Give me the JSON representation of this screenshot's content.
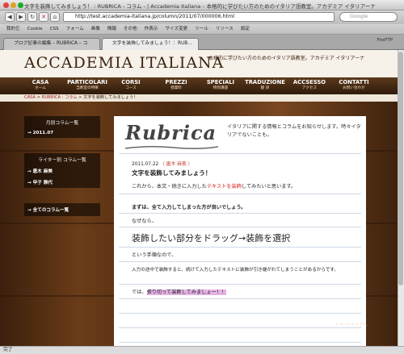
{
  "window": {
    "title": "文字を装飾してみましょう！ : RUBRICA - コラム - | Accademia Italiana – 本格的に学びたい方のためのイタリア語教室。アカデミア イタリアーナ"
  },
  "toolbar": {
    "url": "http://test.accademia-italiana.jp/column/2011/07/000006.html",
    "search_placeholder": "Google",
    "back": "◀",
    "forward": "▶",
    "reload": "↻",
    "home": "⌂"
  },
  "bookmarks": [
    "我的乞",
    "Cookie",
    "CSS",
    "フォーム",
    "画像",
    "情報",
    "その他",
    "作表示",
    "サイズ変更",
    "ツール",
    "リソース",
    "設定"
  ],
  "tabs": [
    {
      "label": "ブログ記事の編集 – RUBRICA – コ"
    },
    {
      "label": "文字を装飾してみましょう！：RUB…"
    }
  ],
  "ffftp_label": "FireFTP",
  "site": {
    "logo": "ACCADEMIA ITALIANA",
    "tagline": "本格的に学びたい方のためのイタリア語教室。アカデミア イタリアーナ",
    "nav": [
      {
        "en": "CASA",
        "jp": "ホーム"
      },
      {
        "en": "PARTICOLARI",
        "jp": "当教室の特徴"
      },
      {
        "en": "CORSI",
        "jp": "コース"
      },
      {
        "en": "PREZZI",
        "jp": "授業料"
      },
      {
        "en": "SPECIALI",
        "jp": "特別講座"
      },
      {
        "en": "TRADUZIONE",
        "jp": "翻 訳"
      },
      {
        "en": "ACCSESSO",
        "jp": "アクセス"
      },
      {
        "en": "CONTATTI",
        "jp": "お問い合わせ"
      }
    ],
    "breadcrumb": [
      "CASA",
      "RUBRICA : コラム",
      "文字を装飾してみましょう！"
    ],
    "sidebar": {
      "monthly_head": "月別コラム一覧",
      "monthly_items": [
        "→ 2011.07"
      ],
      "writer_head": "ライター別 コラム一覧",
      "writer_items": [
        "→ 唐木 麻美",
        "→ 甲子 雅代"
      ],
      "all_columns": "→ 全てのコラム一覧"
    },
    "content": {
      "logo": "Rubrica",
      "description": "イタリアに関する情報とコラムをお知らせします。時々イタリアでないことも。",
      "date": "2011.07.22",
      "author": "（ 唐木 麻美 ）",
      "title": "文字を装飾してみましょう！",
      "p1_before": "これから、本文・続きに入力した",
      "p1_red": "テキストを装飾",
      "p1_after": "してみたいと思います。",
      "p2": "まずは、全て入力してしまった方が良いでしょう。",
      "p3": "なぜなら、",
      "p4": "装飾したい部分をドラッグ→装飾を選択",
      "p5": "という手順なので、",
      "p6": "入力の途中で装飾すると、続けて入力したテキストに装飾が引き継がれてしまうことがあるからです。",
      "p7_before": "では、",
      "p7_highlight": "張り切って装飾してみましょー！！"
    },
    "pagetop": "| ページトップへ"
  },
  "status": "完了",
  "colors": {
    "brown": "#4a2a13",
    "highlight": "#e6b3e6",
    "red_text": "#e02020",
    "author": "#c0392b"
  }
}
